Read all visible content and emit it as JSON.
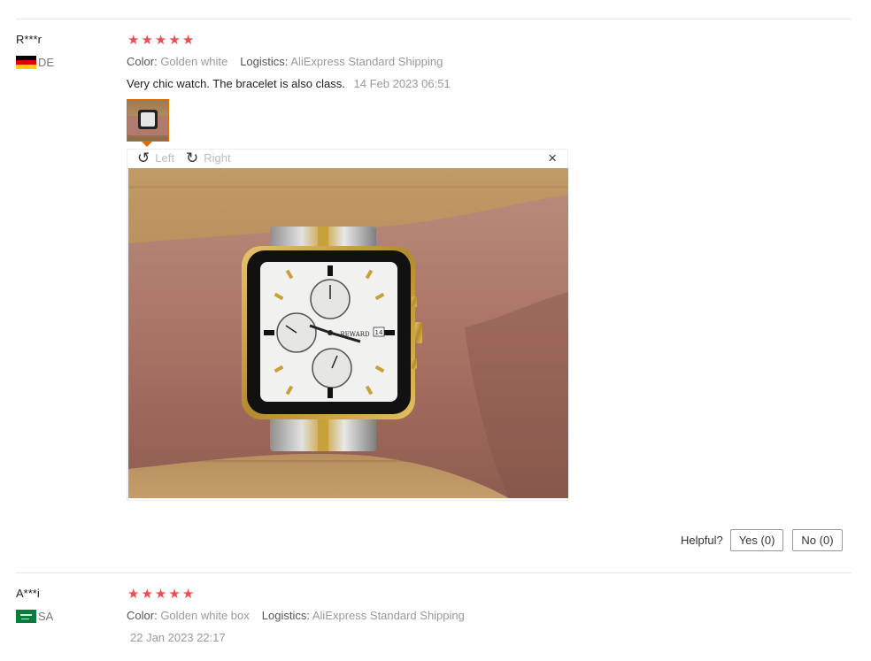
{
  "reviews": [
    {
      "user": "R***r",
      "country": "DE",
      "rating": 5,
      "color_label": "Color:",
      "color_value": "Golden white",
      "logistics_label": "Logistics:",
      "logistics_value": "AliExpress Standard Shipping",
      "feedback": "Very chic watch. The bracelet is also class.",
      "time": "14 Feb 2023 06:51"
    },
    {
      "user": "A***i",
      "country": "SA",
      "rating": 5,
      "color_label": "Color:",
      "color_value": "Golden white box",
      "logistics_label": "Logistics:",
      "logistics_value": "AliExpress Standard Shipping",
      "feedback": "",
      "time": "22 Jan 2023 22:17"
    }
  ],
  "viewer": {
    "rotate_left_label": "Left",
    "rotate_right_label": "Right",
    "close_symbol": "×",
    "photo_watch_brand": "REWARD"
  },
  "helpful": {
    "label": "Helpful?",
    "yes_label": "Yes (0)",
    "no_label": "No (0)"
  },
  "colors": {
    "star": "#ee4e4e",
    "thumb_border": "#e06b00"
  }
}
